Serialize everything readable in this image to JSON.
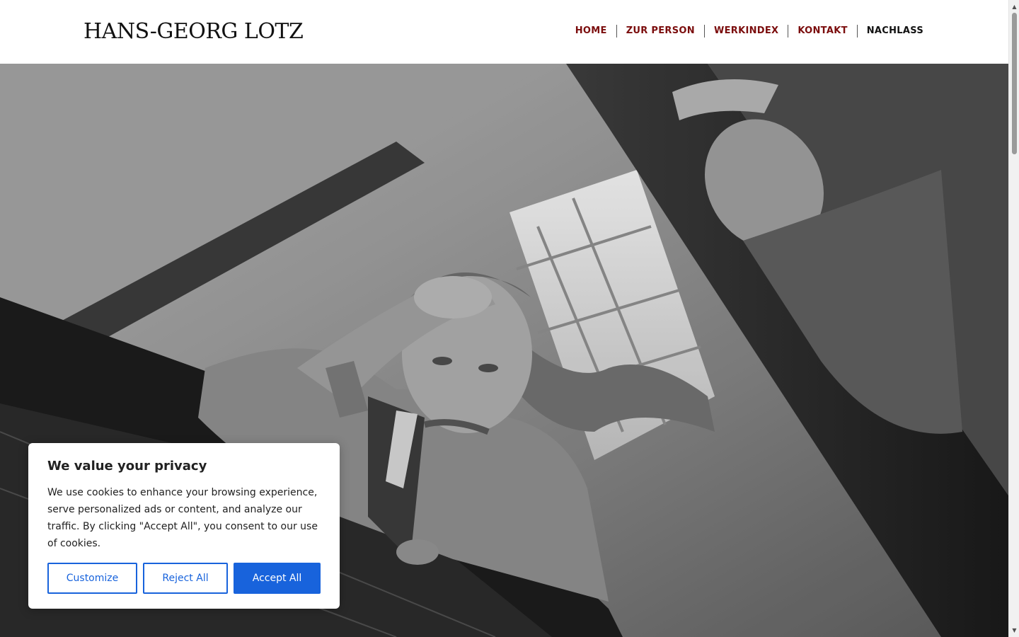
{
  "header": {
    "logo": "HANS-GEORG LOTZ",
    "nav": [
      {
        "label": "HOME",
        "color": "#7b0d0d"
      },
      {
        "label": "ZUR PERSON",
        "color": "#7b0d0d"
      },
      {
        "label": "WERKINDEX",
        "color": "#7b0d0d"
      },
      {
        "label": "KONTAKT",
        "color": "#7b0d0d"
      },
      {
        "label": "NACHLASS",
        "color": "#111111",
        "current": true
      }
    ]
  },
  "hero": {
    "image": "black-and-white photograph of a man at a grand piano with his hand on his head, reflected in the open piano lid"
  },
  "cookie_banner": {
    "title": "We value your privacy",
    "text": "We use cookies to enhance your browsing experience, serve personalized ads or content, and analyze our traffic. By clicking \"Accept All\", you consent to our use of cookies.",
    "buttons": {
      "customize": "Customize",
      "reject": "Reject All",
      "accept": "Accept All"
    },
    "accent_color": "#1863dc"
  },
  "scrollbar": {
    "up_icon": "chevron-up-icon",
    "down_icon": "chevron-down-icon"
  }
}
